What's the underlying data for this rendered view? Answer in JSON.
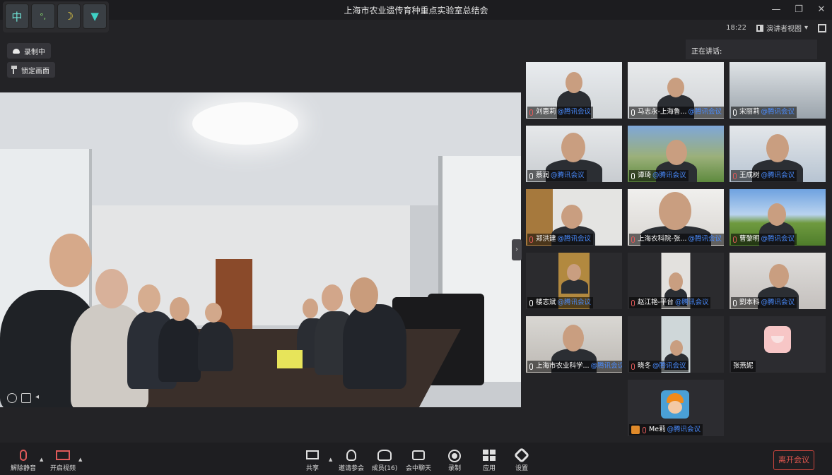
{
  "window": {
    "title": "上海市农业遗传育种重点实验室总结会",
    "controls": [
      "minimize",
      "restore",
      "close"
    ]
  },
  "ime": {
    "buttons": [
      {
        "icon": "chinese-mode-icon",
        "label": "中"
      },
      {
        "icon": "punctuation-icon",
        "label": "°,"
      },
      {
        "icon": "moon-icon",
        "label": "☽"
      },
      {
        "icon": "skin-icon",
        "label": "👕"
      }
    ]
  },
  "header": {
    "time": "18:22",
    "view_label": "演讲者视图"
  },
  "status": {
    "recording": "录制中",
    "lock_view": "锁定画面"
  },
  "speaking": {
    "label": "正在讲话:"
  },
  "participants": [
    {
      "name": "刘惠莉",
      "tag": "@腾讯会议",
      "mic": "off"
    },
    {
      "name": "马志永-上海鲁...",
      "tag": "@腾讯会议",
      "mic": "on"
    },
    {
      "name": "宋丽莉",
      "tag": "@腾讯会议",
      "mic": "on"
    },
    {
      "name": "蔡润",
      "tag": "@腾讯会议",
      "mic": "on"
    },
    {
      "name": "谭琦",
      "tag": "@腾讯会议",
      "mic": "on"
    },
    {
      "name": "王成树",
      "tag": "@腾讯会议",
      "mic": "off"
    },
    {
      "name": "郑洪建",
      "tag": "@腾讯会议",
      "mic": "off"
    },
    {
      "name": "上海农科院-张...",
      "tag": "@腾讯会议",
      "mic": "off"
    },
    {
      "name": "曹黎明",
      "tag": "@腾讯会议",
      "mic": "off"
    },
    {
      "name": "楼志斌",
      "tag": "@腾讯会议",
      "mic": "on"
    },
    {
      "name": "赵江艳-平台",
      "tag": "@腾讯会议",
      "mic": "off"
    },
    {
      "name": "劉本科",
      "tag": "@腾讯会议",
      "mic": "on"
    },
    {
      "name": "上海市农业科学...",
      "tag": "@腾讯会议",
      "mic": "on"
    },
    {
      "name": "晓冬",
      "tag": "@腾讯会议",
      "mic": "off"
    },
    {
      "name": "张燕妮",
      "tag": "",
      "mic": "none"
    },
    {
      "name": "Me莉",
      "tag": "@腾讯会议",
      "mic": "off"
    }
  ],
  "toolbar": {
    "unmute": "解除静音",
    "start_video": "开启视频",
    "share": "共享",
    "invite": "邀请参会",
    "members": "成员(16)",
    "chat": "会中聊天",
    "record": "录制",
    "apps": "应用",
    "settings": "设置",
    "leave": "离开会议"
  }
}
